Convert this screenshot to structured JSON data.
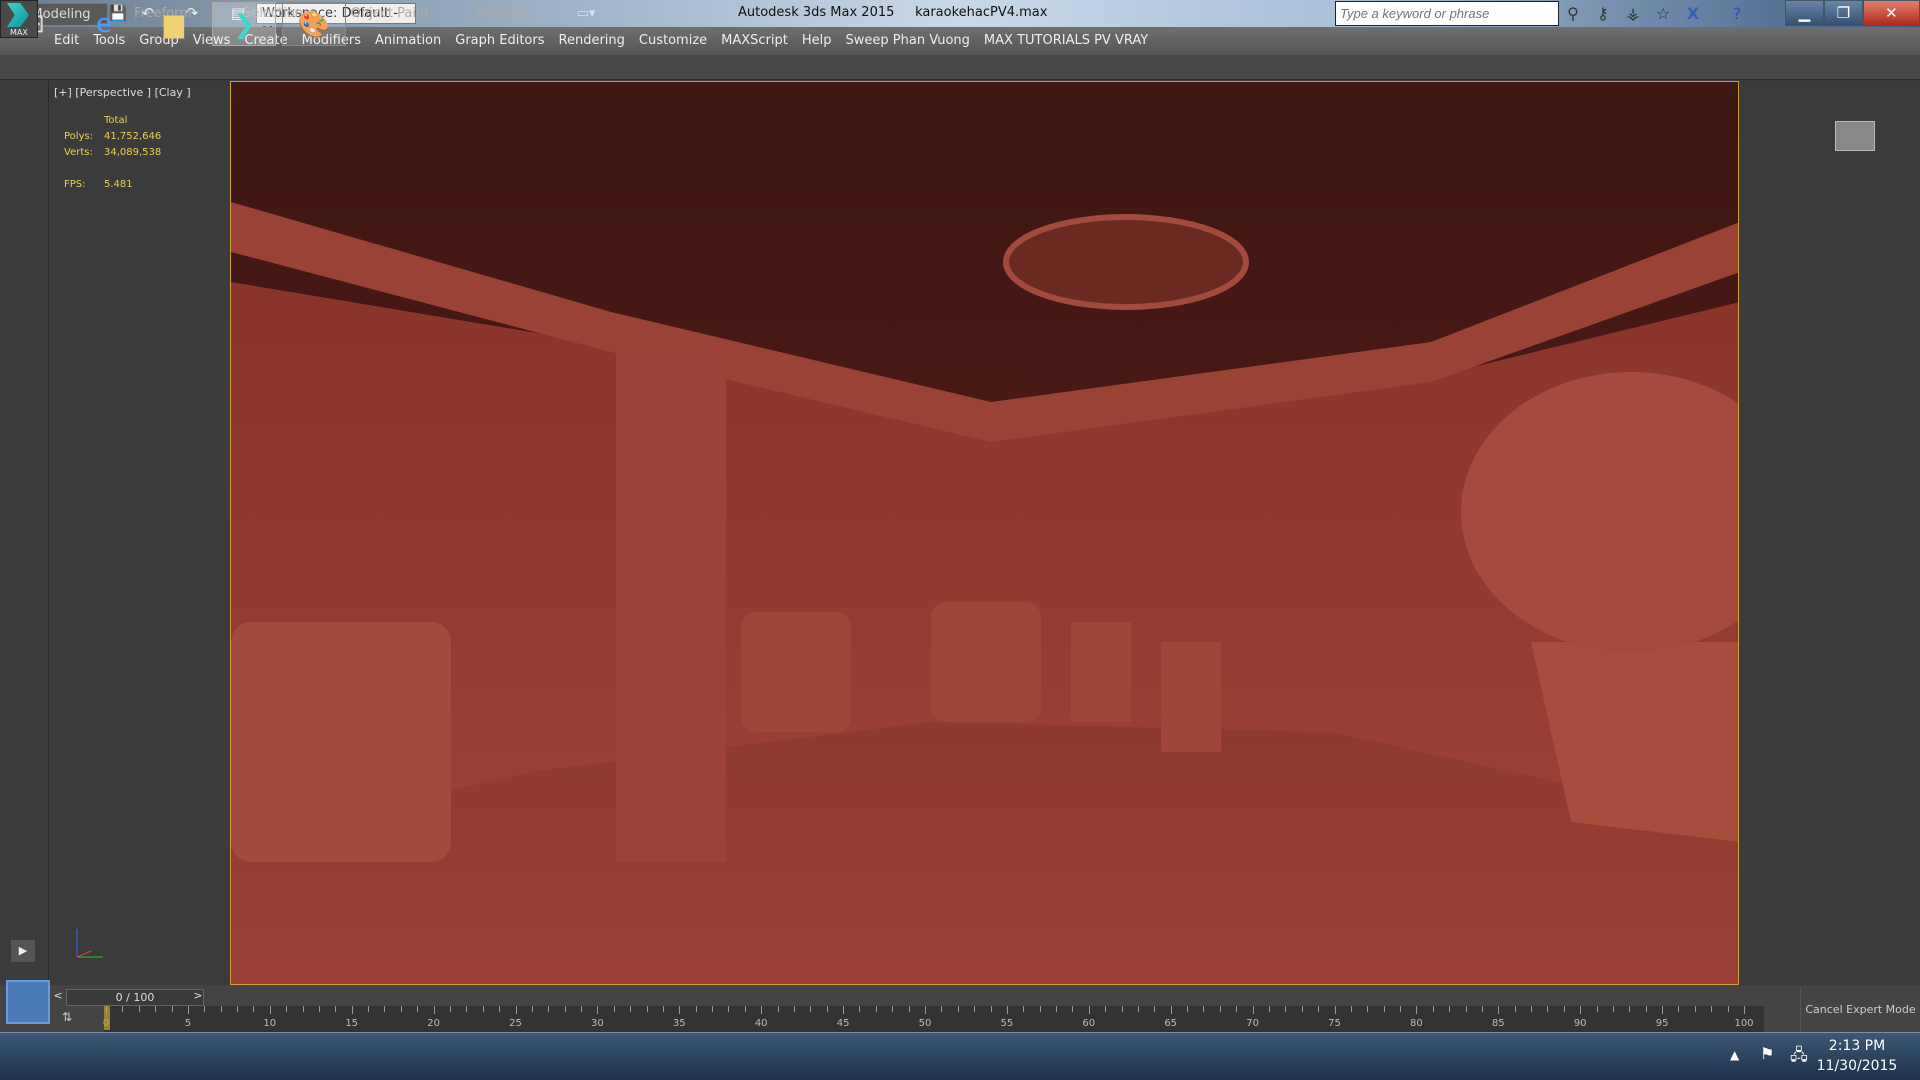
{
  "titlebar": {
    "app_title": "Autodesk 3ds Max  2015",
    "file_name": "karaokehacPV4.max",
    "workspace": "Workspace: Default - M.",
    "search_placeholder": "Type a keyword or phrase",
    "logo_text": "MAX"
  },
  "menu": [
    "Edit",
    "Tools",
    "Group",
    "Views",
    "Create",
    "Modifiers",
    "Animation",
    "Graph Editors",
    "Rendering",
    "Customize",
    "MAXScript",
    "Help",
    "Sweep Phan Vuong",
    "MAX TUTORIALS PV VRAY"
  ],
  "ribbon": {
    "tabs": [
      "Modeling",
      "Freeform",
      "Selection",
      "Object Paint",
      "Populate"
    ],
    "active": "Modeling"
  },
  "viewport": {
    "label": "[+] [Perspective ] [Clay ]",
    "stats": {
      "header": "Total",
      "polys_label": "Polys:",
      "polys": "41,752,646",
      "verts_label": "Verts:",
      "verts": "34,089,538",
      "fps_label": "FPS:",
      "fps": "5.481"
    },
    "clay_color": "#8a3a30",
    "border_color": "#c8a030"
  },
  "timeline": {
    "frame": "0 / 100",
    "prev": "<",
    "next": ">",
    "ticks": [
      0,
      5,
      10,
      15,
      20,
      25,
      30,
      35,
      40,
      45,
      50,
      55,
      60,
      65,
      70,
      75,
      80,
      85,
      90,
      95,
      100
    ],
    "current": 0,
    "cancel_expert": "Cancel Expert Mode"
  },
  "taskbar": {
    "time": "2:13 PM",
    "date": "11/30/2015",
    "apps": [
      "start",
      "internet-explorer",
      "file-explorer",
      "3ds-max",
      "paint"
    ]
  }
}
